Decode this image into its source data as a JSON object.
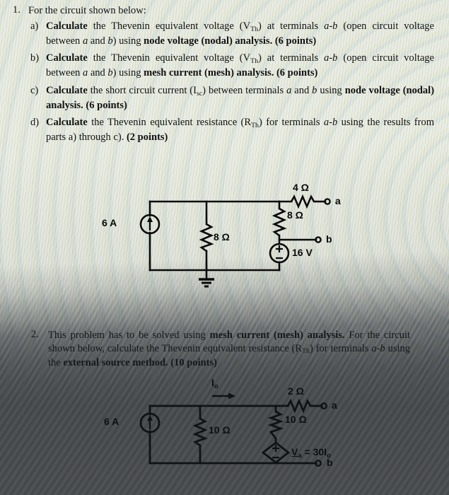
{
  "document": {
    "type": "scanned-homework-page",
    "questions": [
      {
        "number": "1.",
        "stem": "For the circuit shown below:",
        "parts": [
          {
            "marker": "a)",
            "segments": [
              {
                "t": "Calculate",
                "s": "b"
              },
              {
                "t": " the Thevenin equivalent voltage (V",
                "s": "n"
              },
              {
                "t": "Th",
                "s": "sub"
              },
              {
                "t": ") at terminals ",
                "s": "n"
              },
              {
                "t": "a-b",
                "s": "i"
              },
              {
                "t": " (open circuit voltage between ",
                "s": "n"
              },
              {
                "t": "a",
                "s": "i"
              },
              {
                "t": " and ",
                "s": "n"
              },
              {
                "t": "b",
                "s": "i"
              },
              {
                "t": ") using ",
                "s": "n"
              },
              {
                "t": "node voltage (nodal) analysis.",
                "s": "b"
              },
              {
                "t": " ",
                "s": "n"
              },
              {
                "t": "(6 points)",
                "s": "b"
              }
            ]
          },
          {
            "marker": "b)",
            "segments": [
              {
                "t": "Calculate",
                "s": "b"
              },
              {
                "t": " the Thevenin equivalent voltage (V",
                "s": "n"
              },
              {
                "t": "Th",
                "s": "sub"
              },
              {
                "t": ") at terminals ",
                "s": "n"
              },
              {
                "t": "a-b",
                "s": "i"
              },
              {
                "t": " (open circuit voltage between ",
                "s": "n"
              },
              {
                "t": "a",
                "s": "i"
              },
              {
                "t": " and ",
                "s": "n"
              },
              {
                "t": "b",
                "s": "i"
              },
              {
                "t": ") using ",
                "s": "n"
              },
              {
                "t": "mesh current (mesh) analysis.",
                "s": "b"
              },
              {
                "t": " ",
                "s": "n"
              },
              {
                "t": "(6 points)",
                "s": "b"
              }
            ]
          },
          {
            "marker": "c)",
            "segments": [
              {
                "t": "Calculate",
                "s": "b"
              },
              {
                "t": " the short circuit current (I",
                "s": "n"
              },
              {
                "t": "sc",
                "s": "sub"
              },
              {
                "t": ") between terminals ",
                "s": "n"
              },
              {
                "t": "a",
                "s": "i"
              },
              {
                "t": " and ",
                "s": "n"
              },
              {
                "t": "b",
                "s": "i"
              },
              {
                "t": " using ",
                "s": "n"
              },
              {
                "t": "node voltage (nodal) analysis.",
                "s": "b"
              },
              {
                "t": " ",
                "s": "n"
              },
              {
                "t": "(6 points)",
                "s": "b"
              }
            ]
          },
          {
            "marker": "d)",
            "segments": [
              {
                "t": "Calculate",
                "s": "b"
              },
              {
                "t": " the Thevenin equivalent resistance (R",
                "s": "n"
              },
              {
                "t": "Th",
                "s": "sub"
              },
              {
                "t": ") for terminals ",
                "s": "n"
              },
              {
                "t": "a-b",
                "s": "i"
              },
              {
                "t": " using the results from parts a) through c). ",
                "s": "n"
              },
              {
                "t": "(2 points)",
                "s": "b"
              }
            ]
          }
        ]
      },
      {
        "number": "2.",
        "segments": [
          {
            "t": "This problem has to be solved using ",
            "s": "n"
          },
          {
            "t": "mesh current (mesh) analysis.",
            "s": "b"
          },
          {
            "t": " For the circuit shown below, calculate the Thevenin equivalent resistance (R",
            "s": "n"
          },
          {
            "t": "Th",
            "s": "sub"
          },
          {
            "t": ") for terminals ",
            "s": "n"
          },
          {
            "t": "a-b",
            "s": "i"
          },
          {
            "t": " using the ",
            "s": "n"
          },
          {
            "t": "external source method.",
            "s": "b"
          },
          {
            "t": " ",
            "s": "n"
          },
          {
            "t": "(10 points)",
            "s": "b"
          }
        ]
      }
    ]
  },
  "circuit1": {
    "name": "thevenin-circuit-1",
    "current_source": "6 A",
    "resistor_shunt": "8 Ω",
    "resistor_series_top": "4 Ω",
    "resistor_branch": "8 Ω",
    "voltage_source": "16 V",
    "terminal_a": "a",
    "terminal_b": "b",
    "plus_sign": "+",
    "minus_sign": "−",
    "ground": "ground-symbol"
  },
  "circuit2": {
    "name": "external-source-circuit-2",
    "current_source": "6 A",
    "current_label": "I",
    "current_label_sub": "o",
    "resistor_shunt": "10 Ω",
    "resistor_series_top": "2 Ω",
    "resistor_branch": "10 Ω",
    "dependent_source_label": "V",
    "dependent_source_label_sub": "a",
    "dependent_source_expr": " = 30I",
    "dependent_source_expr_sub": "o",
    "terminal_a": "a",
    "terminal_b": "b",
    "plus_sign": "+",
    "minus_sign": "−"
  },
  "colors": {
    "ink": "#121212",
    "paper_top": "#e8ebe2",
    "paper_bottom": "#4c4f52"
  }
}
